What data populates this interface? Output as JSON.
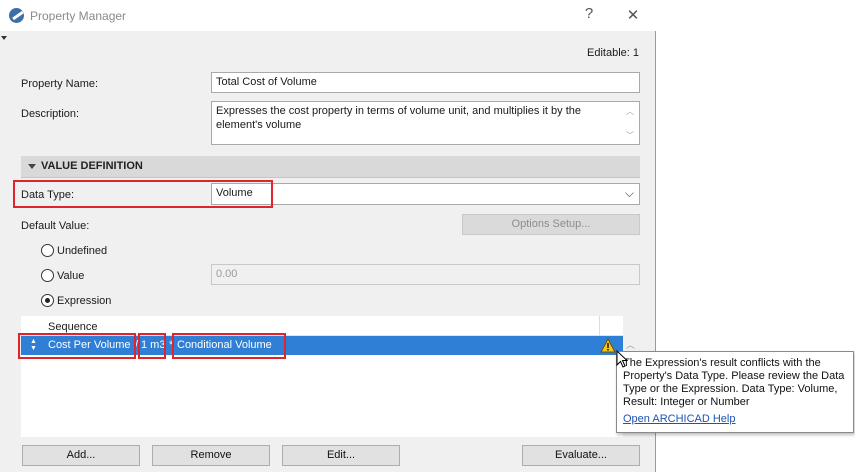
{
  "window": {
    "title": "Property Manager",
    "help_glyph": "?",
    "close_glyph": "✕"
  },
  "editable": "Editable: 1",
  "property_name": {
    "label": "Property Name:",
    "value": "Total Cost of Volume"
  },
  "description": {
    "label": "Description:",
    "value": "Expresses the cost property in terms of volume unit, and multiplies it by the element's volume"
  },
  "value_definition": {
    "section_title": "VALUE DEFINITION",
    "data_type_label": "Data Type:",
    "data_type_value": "Volume",
    "default_value_label": "Default Value:",
    "options_setup_label": "Options Setup...",
    "radio_undefined": "Undefined",
    "radio_value": "Value",
    "value_field": "0.00",
    "radio_expression": "Expression",
    "selected_radio": "Expression"
  },
  "sequence": {
    "header": "Sequence",
    "tokens": [
      "Cost Per Volume",
      "/",
      "1 m3",
      "*",
      "Conditional Volume"
    ]
  },
  "tooltip": {
    "message": "The Expression's result conflicts with the Property's Data Type. Please review the Data Type or the Expression. Data Type: Volume, Result: Integer or Number",
    "link": "Open ARCHICAD Help"
  },
  "buttons": {
    "add": "Add...",
    "remove": "Remove",
    "edit": "Edit...",
    "evaluate": "Evaluate..."
  },
  "colors": {
    "selection": "#2f7fd6",
    "highlight_box": "#e0242a",
    "warning": "#f5c518"
  },
  "icons": {
    "app": "archicad-logo-icon",
    "warning": "warning-triangle-icon",
    "dropdown": "chevron-down-icon",
    "sort": "sort-arrows-icon"
  }
}
